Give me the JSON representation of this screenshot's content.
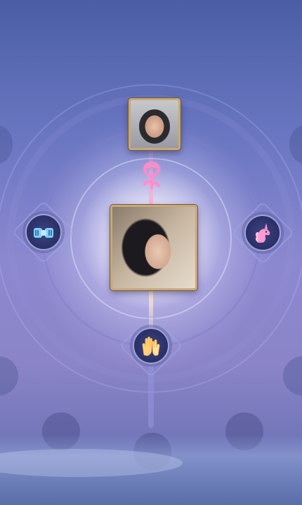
{
  "scene": {
    "colors": {
      "sky_top": "#4a5ea5",
      "sky_mid": "#8c88d0",
      "frame_gold": "#c9a877",
      "emblem_dark": "#2a2f66",
      "rose_pink": "#ff8cc8",
      "unicorn_pink": "#ff9ad2",
      "hands_gold": "#ffd27a",
      "fist_blue": "#7fd0ff"
    },
    "nodes": {
      "top_portrait": {
        "icon": "portrait-photo"
      },
      "center_portrait": {
        "icon": "portrait-photo"
      },
      "top_connector": {
        "icon": "rose-icon"
      },
      "left_emblem": {
        "icon": "fist-bump-icon"
      },
      "right_emblem": {
        "icon": "unicorn-icon"
      },
      "bottom_emblem": {
        "icon": "clapping-hands-icon"
      }
    },
    "empty_slots": 5
  }
}
